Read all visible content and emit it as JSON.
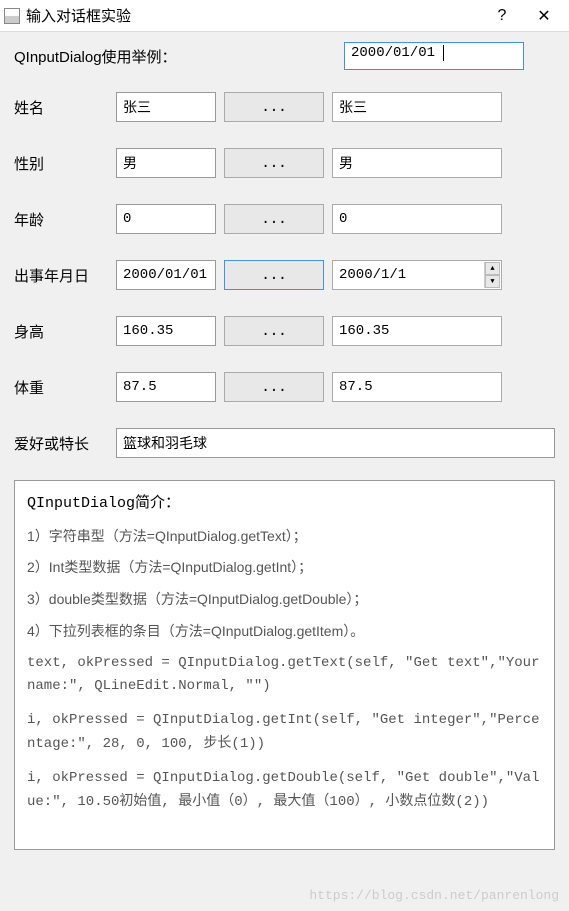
{
  "window": {
    "title": "输入对话框实验",
    "help": "?",
    "close": "✕"
  },
  "header": {
    "label": "QInputDialog使用举例：",
    "active_value": "2000/01/01"
  },
  "fields": [
    {
      "label": "姓名",
      "input": "张三",
      "ellipsis": "...",
      "output": "张三",
      "active": false,
      "spin": false
    },
    {
      "label": "性别",
      "input": "男",
      "ellipsis": "...",
      "output": "男",
      "active": false,
      "spin": false
    },
    {
      "label": "年龄",
      "input": "0",
      "ellipsis": "...",
      "output": "0",
      "active": false,
      "spin": false
    },
    {
      "label": "出事年月日",
      "input": "2000/01/01",
      "ellipsis": "...",
      "output": "2000/1/1",
      "active": true,
      "spin": true
    },
    {
      "label": "身高",
      "input": "160.35",
      "ellipsis": "...",
      "output": "160.35",
      "active": false,
      "spin": false
    },
    {
      "label": "体重",
      "input": "87.5",
      "ellipsis": "...",
      "output": "87.5",
      "active": false,
      "spin": false
    }
  ],
  "hobby": {
    "label": "爱好或特长",
    "value": "篮球和羽毛球"
  },
  "info": {
    "title": "QInputDialog简介：",
    "lines": [
      "1）字符串型（方法=QInputDialog.getText）；",
      "2）Int类型数据（方法=QInputDialog.getInt）；",
      "3）double类型数据（方法=QInputDialog.getDouble）；",
      "4）下拉列表框的条目（方法=QInputDialog.getItem）。"
    ],
    "code": [
      "text, okPressed = QInputDialog.getText(self, \"Get text\",\"Your name:\", QLineEdit.Normal, \"\")",
      "i, okPressed = QInputDialog.getInt(self, \"Get integer\",\"Percentage:\", 28, 0, 100, 步长(1))",
      "i, okPressed = QInputDialog.getDouble(self, \"Get double\",\"Value:\", 10.50初始值, 最小值（0）, 最大值（100）, 小数点位数(2))"
    ]
  },
  "watermark": "https://blog.csdn.net/panrenlong"
}
